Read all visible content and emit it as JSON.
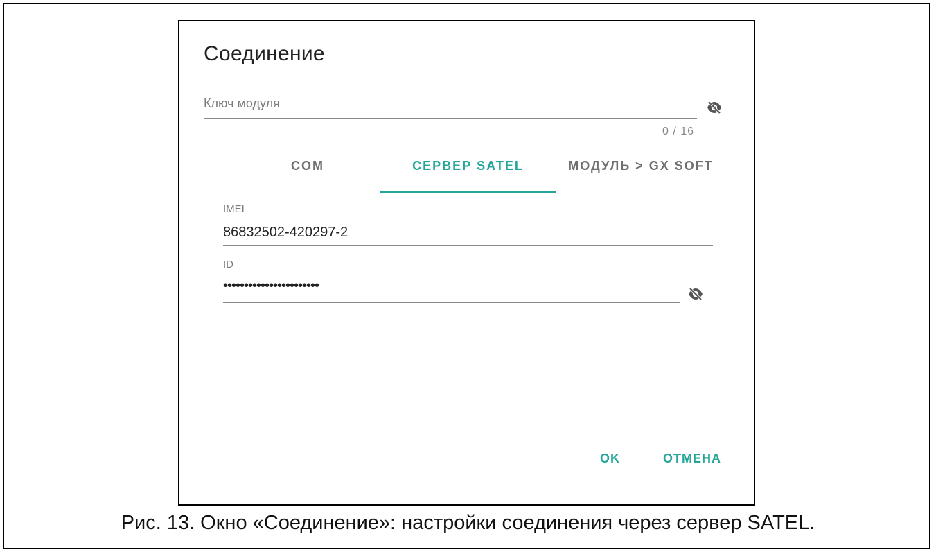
{
  "dialog": {
    "title": "Соединение",
    "module_key": {
      "label": "Ключ модуля",
      "value": "",
      "counter": "0 / 16",
      "visibility_icon": "eye-off-icon"
    },
    "tabs": [
      {
        "label": "COM",
        "active": false
      },
      {
        "label": "СЕРВЕР SATEL",
        "active": true
      },
      {
        "label": "МОДУЛЬ > GX SOFT",
        "active": false
      }
    ],
    "imei": {
      "label": "IMEI",
      "value": "86832502-420297-2"
    },
    "id": {
      "label": "ID",
      "value": "•••••••••••••••••••••••",
      "visibility_icon": "eye-off-icon"
    },
    "buttons": {
      "ok": "OK",
      "cancel": "ОТМЕНА"
    }
  },
  "caption": "Рис. 13. Окно «Соединение»: настройки соединения через сервер SATEL.",
  "colors": {
    "accent": "#26a69a",
    "text": "#222222",
    "muted": "#7a7a7a"
  }
}
